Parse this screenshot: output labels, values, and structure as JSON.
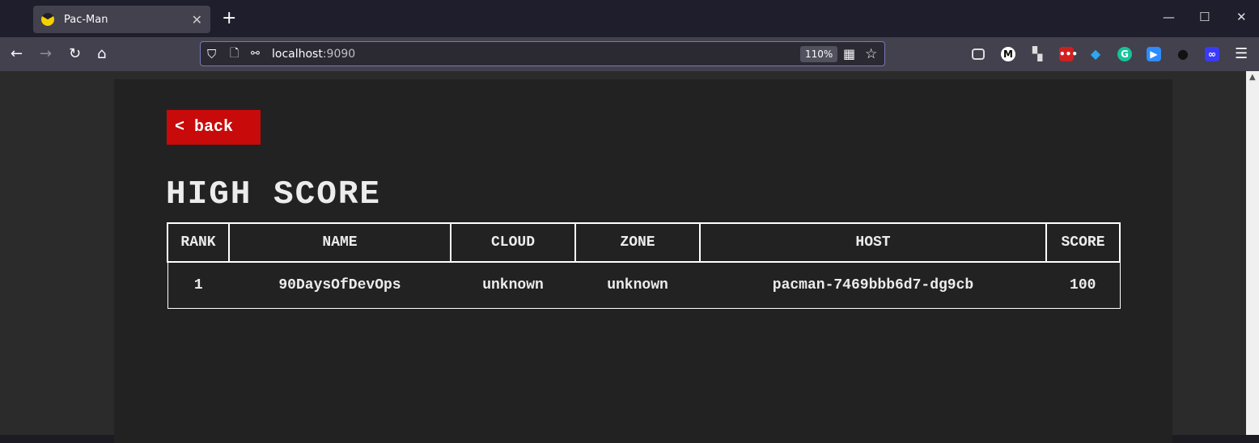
{
  "browser": {
    "tab_title": "Pac-Man",
    "url_host": "localhost",
    "url_port": ":9090",
    "zoom": "110%"
  },
  "page": {
    "back_label": "< back",
    "title": "HIGH SCORE",
    "table": {
      "headers": [
        "RANK",
        "NAME",
        "CLOUD",
        "ZONE",
        "HOST",
        "SCORE"
      ],
      "rows": [
        [
          "1",
          "90DaysOfDevOps",
          "unknown",
          "unknown",
          "pacman-7469bbb6d7-dg9cb",
          "100"
        ]
      ]
    }
  },
  "colors": {
    "back_button": "#c90a0a",
    "panel": "#222222",
    "accent_url_border": "#7a77b8"
  }
}
